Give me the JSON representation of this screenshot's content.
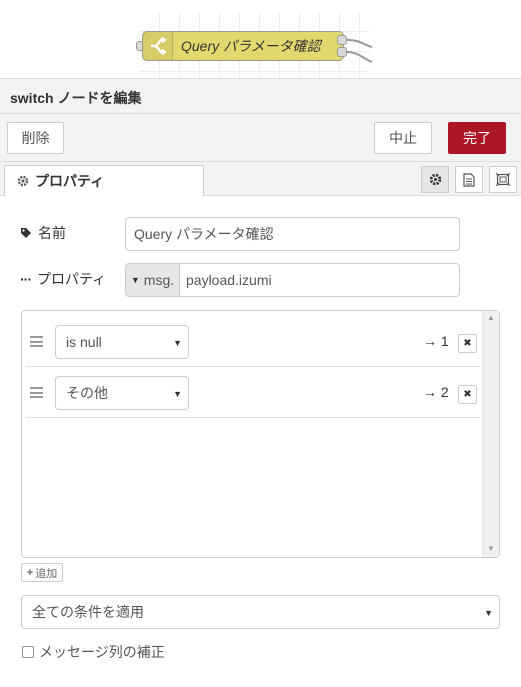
{
  "workspace": {
    "node": {
      "label": "Query パラメータ確認",
      "color": "#e2d96e",
      "icon": "switch-icon"
    }
  },
  "tray": {
    "title": "switch ノードを編集",
    "buttons": {
      "delete": "削除",
      "cancel": "中止",
      "done": "完了"
    },
    "tabs": {
      "properties": "プロパティ"
    },
    "tab_icons": [
      "gear-icon",
      "document-icon",
      "frame-icon"
    ],
    "fields": {
      "name_label": "名前",
      "name_value": "Query パラメータ確認",
      "property_label": "プロパティ",
      "property_type": "msg.",
      "property_value": "payload.izumi"
    },
    "rules": [
      {
        "operator": "is null",
        "output": "→ 1"
      },
      {
        "operator": "その他",
        "output": "→ 2"
      }
    ],
    "add_label": "追加",
    "checking_mode": "全ての条件を適用",
    "recreate_sequence_label": "メッセージ列の補正"
  },
  "colors": {
    "primary": "#ad1625",
    "node": "#e2d96e"
  }
}
